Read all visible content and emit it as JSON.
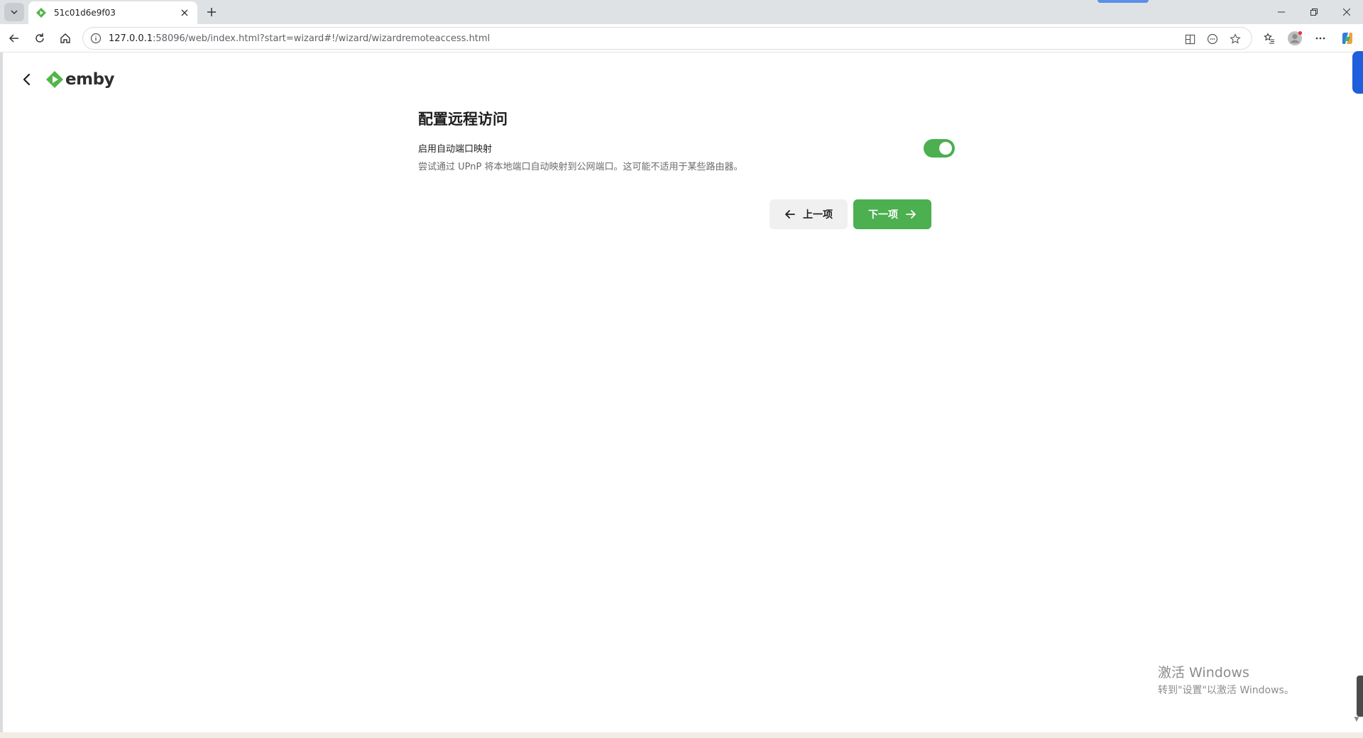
{
  "browser": {
    "tab_title": "51c01d6e9f03",
    "url_host": "127.0.0.1",
    "url_rest": ":58096/web/index.html?start=wizard#!/wizard/wizardremoteaccess.html"
  },
  "app": {
    "logo_text": "emby",
    "accent_color": "#4caf50"
  },
  "wizard": {
    "heading": "配置远程访问",
    "upnp": {
      "label": "启用自动端口映射",
      "description": "尝试通过 UPnP 将本地端口自动映射到公网端口。这可能不适用于某些路由器。",
      "enabled": true
    },
    "prev_label": "上一项",
    "next_label": "下一项"
  },
  "watermark": {
    "line1": "激活 Windows",
    "line2": "转到\"设置\"以激活 Windows。"
  }
}
